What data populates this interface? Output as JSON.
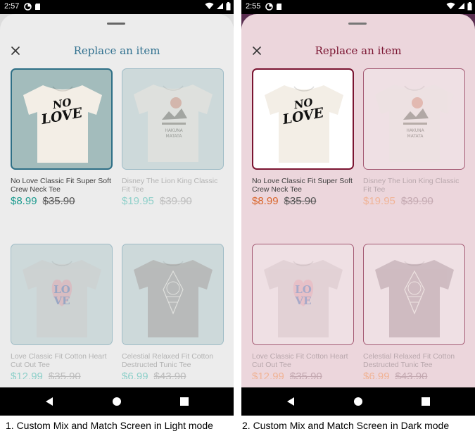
{
  "screens": [
    {
      "mode": "light",
      "status_time": "2:57",
      "title": "Replace an item",
      "caption": "1. Custom Mix and Match Screen in Light mode",
      "colors": {
        "sheet_bg": "#ececec",
        "outer_bg": "#dcdcdc",
        "title": "#2e6f8e",
        "card_bg": "#cdd9da",
        "card_border": "#9fbcc6",
        "selected_bg": "#a3bcbc",
        "selected_border": "#2e6f86",
        "price": "#1a9a8e",
        "price_faded": "#8fd0ca",
        "text": "#404040",
        "text_faded": "#b3b3b3",
        "old_price": "#555555",
        "old_faded": "#bdbdbd",
        "handle": "#666666"
      },
      "products": [
        {
          "name": "No Love Classic Fit Super Soft Crew Neck Tee",
          "price": "$8.99",
          "old_price": "$35.90",
          "selected": true,
          "print": "no-love",
          "shirt_color": "#f3eee6"
        },
        {
          "name": "Disney The Lion King Classic Fit Tee",
          "price": "$19.95",
          "old_price": "$39.90",
          "selected": false,
          "print": "lion-king",
          "shirt_color": "#ede7e0"
        },
        {
          "name": "Love Classic Fit Cotton Heart Cut Out Tee",
          "price": "$12.99",
          "old_price": "$35.90",
          "selected": false,
          "print": "love-heart",
          "shirt_color": "#cdcdcd"
        },
        {
          "name": "Celestial Relaxed Fit Cotton Destructed Tunic Tee",
          "price": "$6.99",
          "old_price": "$43.90",
          "selected": false,
          "print": "celestial",
          "shirt_color": "#a8a2a0"
        }
      ]
    },
    {
      "mode": "dark",
      "status_time": "2:55",
      "title": "Replace an item",
      "caption": "2. Custom Mix and Match Screen in Dark mode",
      "colors": {
        "sheet_bg": "#ecd6dc",
        "outer_bg": "#5a2e50",
        "title": "#7a1431",
        "card_bg": "#efe0e4",
        "card_border": "#a45a73",
        "selected_bg": "#ffffff",
        "selected_border": "#7a1431",
        "price": "#d9652a",
        "price_faded": "#f0b497",
        "text": "#404040",
        "text_faded": "#b8a7ac",
        "old_price": "#555555",
        "old_faded": "#c4a9b1",
        "handle": "#777777"
      },
      "products": [
        {
          "name": "No Love Classic Fit Super Soft Crew Neck Tee",
          "price": "$8.99",
          "old_price": "$35.90",
          "selected": true,
          "print": "no-love",
          "shirt_color": "#f3eee6"
        },
        {
          "name": "Disney The Lion King Classic Fit Tee",
          "price": "$19.95",
          "old_price": "$39.90",
          "selected": false,
          "print": "lion-king",
          "shirt_color": "#ece2e2"
        },
        {
          "name": "Love Classic Fit Cotton Heart Cut Out Tee",
          "price": "$12.99",
          "old_price": "$35.90",
          "selected": false,
          "print": "love-heart",
          "shirt_color": "#d8c6ca"
        },
        {
          "name": "Celestial Relaxed Fit Cotton Destructed Tunic Tee",
          "price": "$6.99",
          "old_price": "$43.90",
          "selected": false,
          "print": "celestial",
          "shirt_color": "#b59ea6"
        }
      ]
    }
  ],
  "icons": {
    "status_left": [
      "data-saver-icon",
      "sd-card-icon"
    ],
    "status_right": [
      "wifi-icon",
      "signal-icon",
      "battery-icon"
    ],
    "close": "close-icon",
    "nav": [
      "back-icon",
      "home-icon",
      "recents-icon"
    ]
  }
}
